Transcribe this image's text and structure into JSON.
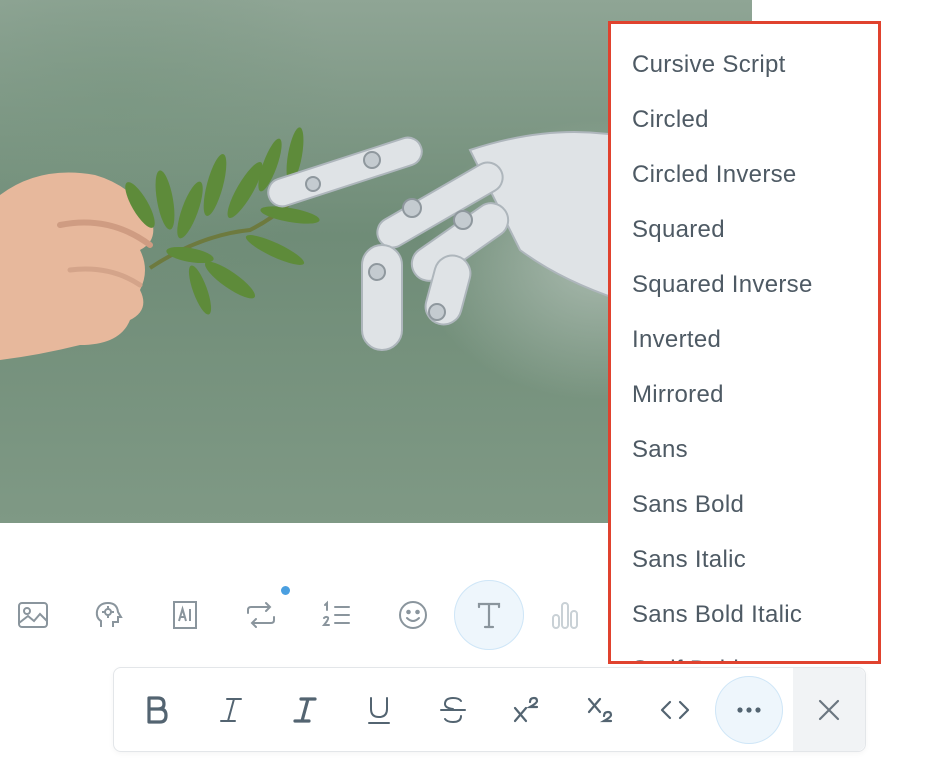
{
  "media": {
    "alt_icon": "image-of-human-hand-and-robot-hand"
  },
  "compose_toolbar": {
    "icons": [
      "image-icon",
      "head-icon",
      "ai-icon",
      "repost-icon",
      "numbered-list-icon",
      "emoji-icon",
      "text-format-icon",
      "poll-chart-icon"
    ],
    "notification_dot_color": "#4a9fe0",
    "active_icon": "text-format-icon"
  },
  "format_bar": {
    "buttons": [
      "bold",
      "italic",
      "bold-italic",
      "underline",
      "strikethrough",
      "superscript",
      "subscript",
      "code",
      "more"
    ],
    "active_button": "more",
    "accent_color": "#eef6fc"
  },
  "font_menu": {
    "border_color": "#e0422e",
    "items": [
      "Cursive Script",
      "Circled",
      "Circled Inverse",
      "Squared",
      "Squared Inverse",
      "Inverted",
      "Mirrored",
      "Sans",
      "Sans Bold",
      "Sans Italic",
      "Sans Bold Italic",
      "Serif Bold"
    ]
  }
}
